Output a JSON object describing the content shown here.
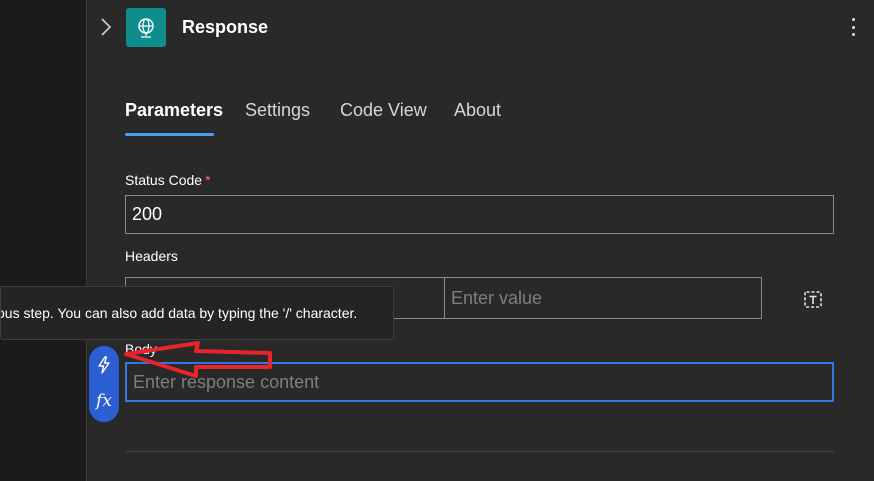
{
  "header": {
    "title": "Response",
    "icon": "globe-connector-icon",
    "icon_bg": "#0f8c8c"
  },
  "tabs": [
    {
      "label": "Parameters",
      "active": true
    },
    {
      "label": "Settings",
      "active": false
    },
    {
      "label": "Code View",
      "active": false
    },
    {
      "label": "About",
      "active": false
    }
  ],
  "status_code": {
    "label": "Status Code",
    "required_mark": "*",
    "value": "200"
  },
  "headers": {
    "label": "Headers",
    "key_value": "",
    "value_placeholder": "Enter value"
  },
  "tooltip": {
    "text": "ous step. You can also add data by typing the '/' character."
  },
  "body": {
    "label": "Body",
    "placeholder": "Enter response content"
  },
  "token_picker": {
    "dynamic_icon": "lightning-icon",
    "expression_label": "fx"
  },
  "colors": {
    "accent": "#4aa0f0",
    "focus_border": "#2f78e6",
    "token_pill": "#2c5fd1",
    "annotation_arrow": "#e8232a"
  }
}
